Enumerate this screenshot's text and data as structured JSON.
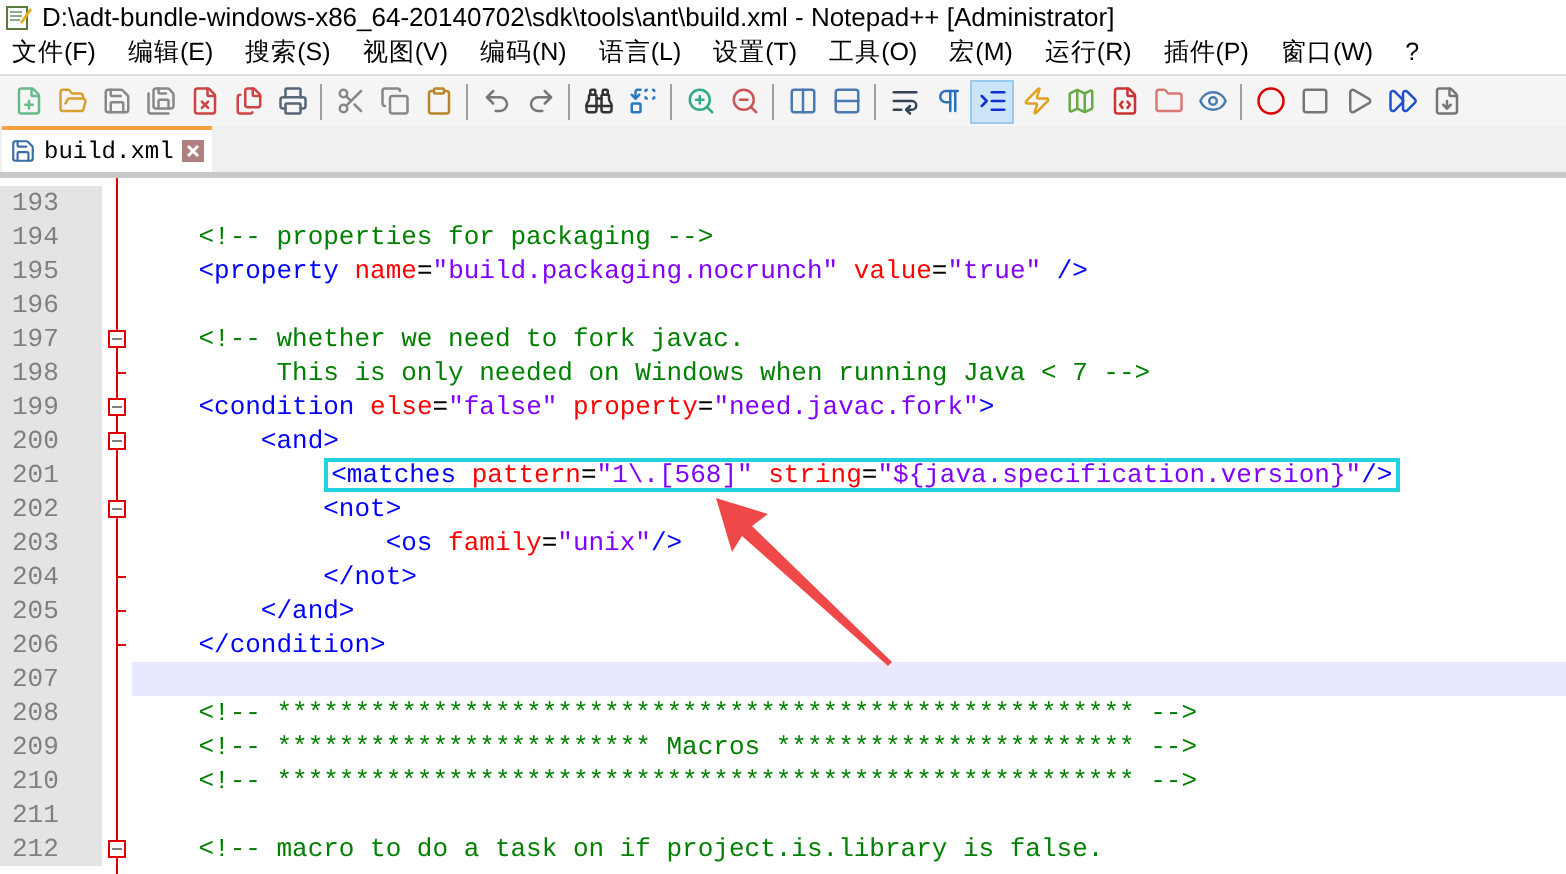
{
  "window": {
    "title": "D:\\adt-bundle-windows-x86_64-20140702\\sdk\\tools\\ant\\build.xml - Notepad++ [Administrator]"
  },
  "menu": [
    "文件(F)",
    "编辑(E)",
    "搜索(S)",
    "视图(V)",
    "编码(N)",
    "语言(L)",
    "设置(T)",
    "工具(O)",
    "宏(M)",
    "运行(R)",
    "插件(P)",
    "窗口(W)",
    "?"
  ],
  "toolbar_groups": [
    [
      {
        "kind": "new",
        "selected": false
      },
      {
        "kind": "open",
        "selected": false
      },
      {
        "kind": "save",
        "selected": false
      },
      {
        "kind": "save_all",
        "selected": false
      },
      {
        "kind": "close",
        "selected": false
      },
      {
        "kind": "close_all",
        "selected": false
      },
      {
        "kind": "print",
        "selected": false
      }
    ],
    [
      {
        "kind": "cut",
        "selected": false
      },
      {
        "kind": "copy",
        "selected": false
      },
      {
        "kind": "paste",
        "selected": false
      }
    ],
    [
      {
        "kind": "undo",
        "selected": false
      },
      {
        "kind": "redo",
        "selected": false
      }
    ],
    [
      {
        "kind": "find",
        "selected": false
      },
      {
        "kind": "replace",
        "selected": false
      }
    ],
    [
      {
        "kind": "zoom_in",
        "selected": false
      },
      {
        "kind": "zoom_out",
        "selected": false
      }
    ],
    [
      {
        "kind": "sync_v",
        "selected": false
      },
      {
        "kind": "sync_h",
        "selected": false
      }
    ],
    [
      {
        "kind": "wrap",
        "selected": false
      },
      {
        "kind": "show_all",
        "selected": false
      },
      {
        "kind": "indent_guide",
        "selected": true
      },
      {
        "kind": "udl",
        "selected": false
      },
      {
        "kind": "doc_map",
        "selected": false
      },
      {
        "kind": "function_list",
        "selected": false
      },
      {
        "kind": "folder",
        "selected": false
      },
      {
        "kind": "monitor",
        "selected": false
      }
    ],
    [
      {
        "kind": "record",
        "selected": false
      },
      {
        "kind": "stop",
        "selected": false
      },
      {
        "kind": "play",
        "selected": false
      },
      {
        "kind": "play_multi",
        "selected": false
      },
      {
        "kind": "save_macro",
        "selected": false
      }
    ]
  ],
  "tabs": [
    {
      "label": "build.xml",
      "selected": true
    }
  ],
  "editor": {
    "lines": [
      {
        "number": "193",
        "fold_open": false,
        "fold_end": false,
        "selected": false
      },
      {
        "number": "194",
        "fold_open": false,
        "fold_end": false,
        "selected": false,
        "tokens": [
          {
            "kind": "comment",
            "text": "    <!-- properties for packaging -->"
          }
        ]
      },
      {
        "number": "195",
        "fold_open": false,
        "fold_end": false,
        "selected": false,
        "tokens": [
          {
            "kind": "tag",
            "text": "    <property"
          },
          {
            "kind": "attr",
            "text": " name"
          },
          {
            "kind": "plain",
            "text": "="
          },
          {
            "kind": "value",
            "text": "\"build.packaging.nocrunch\""
          },
          {
            "kind": "attr",
            "text": " value"
          },
          {
            "kind": "plain",
            "text": "="
          },
          {
            "kind": "value",
            "text": "\"true\""
          },
          {
            "kind": "tag",
            "text": " />"
          }
        ]
      },
      {
        "number": "196",
        "fold_open": false,
        "fold_end": false,
        "selected": false
      },
      {
        "number": "197",
        "fold_open": true,
        "fold_end": false,
        "selected": false,
        "tokens": [
          {
            "kind": "comment",
            "text": "    <!-- whether we need to fork javac."
          }
        ]
      },
      {
        "number": "198",
        "fold_open": false,
        "fold_end": true,
        "selected": false,
        "tokens": [
          {
            "kind": "comment",
            "text": "         This is only needed on Windows when running Java < 7 -->"
          }
        ]
      },
      {
        "number": "199",
        "fold_open": true,
        "fold_end": false,
        "selected": false,
        "tokens": [
          {
            "kind": "tag",
            "text": "    <condition"
          },
          {
            "kind": "attr",
            "text": " else"
          },
          {
            "kind": "plain",
            "text": "="
          },
          {
            "kind": "value",
            "text": "\"false\""
          },
          {
            "kind": "attr",
            "text": " property"
          },
          {
            "kind": "plain",
            "text": "="
          },
          {
            "kind": "value",
            "text": "\"need.javac.fork\""
          },
          {
            "kind": "tag",
            "text": ">"
          }
        ]
      },
      {
        "number": "200",
        "fold_open": true,
        "fold_end": false,
        "selected": false,
        "tokens": [
          {
            "kind": "tag",
            "text": "        <and>"
          }
        ]
      },
      {
        "number": "201",
        "fold_open": false,
        "fold_end": false,
        "selected": false,
        "boxed": true,
        "tokens": [
          {
            "kind": "tag",
            "text": "            <matches"
          },
          {
            "kind": "attr",
            "text": " pattern"
          },
          {
            "kind": "plain",
            "text": "="
          },
          {
            "kind": "value",
            "text": "\"1\\.[568]\""
          },
          {
            "kind": "attr",
            "text": " string"
          },
          {
            "kind": "plain",
            "text": "="
          },
          {
            "kind": "value",
            "text": "\"${java.specification.version}\""
          },
          {
            "kind": "tag",
            "text": "/>"
          }
        ]
      },
      {
        "number": "202",
        "fold_open": true,
        "fold_end": false,
        "selected": false,
        "tokens": [
          {
            "kind": "tag",
            "text": "            <not>"
          }
        ]
      },
      {
        "number": "203",
        "fold_open": false,
        "fold_end": false,
        "selected": false,
        "tokens": [
          {
            "kind": "tag",
            "text": "                <os"
          },
          {
            "kind": "attr",
            "text": " family"
          },
          {
            "kind": "plain",
            "text": "="
          },
          {
            "kind": "value",
            "text": "\"unix\""
          },
          {
            "kind": "tag",
            "text": "/>"
          }
        ]
      },
      {
        "number": "204",
        "fold_open": false,
        "fold_end": true,
        "selected": false,
        "tokens": [
          {
            "kind": "tag",
            "text": "            </not>"
          }
        ]
      },
      {
        "number": "205",
        "fold_open": false,
        "fold_end": true,
        "selected": false,
        "tokens": [
          {
            "kind": "tag",
            "text": "        </and>"
          }
        ]
      },
      {
        "number": "206",
        "fold_open": false,
        "fold_end": true,
        "selected": false,
        "tokens": [
          {
            "kind": "tag",
            "text": "    </condition>"
          }
        ]
      },
      {
        "number": "207",
        "fold_open": false,
        "fold_end": false,
        "selected": true
      },
      {
        "number": "208",
        "fold_open": false,
        "fold_end": false,
        "selected": false,
        "tokens": [
          {
            "kind": "comment",
            "text": "    <!-- ******************************************************* -->"
          }
        ]
      },
      {
        "number": "209",
        "fold_open": false,
        "fold_end": false,
        "selected": false,
        "tokens": [
          {
            "kind": "comment",
            "text": "    <!-- ************************ Macros *********************** -->"
          }
        ]
      },
      {
        "number": "210",
        "fold_open": false,
        "fold_end": false,
        "selected": false,
        "tokens": [
          {
            "kind": "comment",
            "text": "    <!-- ******************************************************* -->"
          }
        ]
      },
      {
        "number": "211",
        "fold_open": false,
        "fold_end": false,
        "selected": false
      },
      {
        "number": "212",
        "fold_open": true,
        "fold_end": false,
        "selected": false,
        "tokens": [
          {
            "kind": "comment",
            "text": "    <!-- macro to do a task on if project.is.library is false."
          }
        ]
      }
    ]
  }
}
